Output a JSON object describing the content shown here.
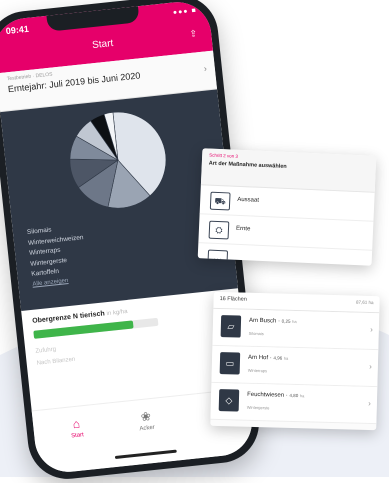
{
  "status": {
    "time": "09:41",
    "icons": "●●● ■"
  },
  "header": {
    "title": "Start",
    "share_icon": "share-icon"
  },
  "farm": {
    "label": "Testbetrieb · DELOS",
    "harvest_year": "Erntejahr: Juli 2019 bis Juni 2020"
  },
  "chart_data": {
    "type": "pie",
    "values": [
      40,
      15,
      12,
      10,
      8,
      7,
      5,
      3
    ],
    "colors": [
      "#dfe4ec",
      "#9aa4b3",
      "#6d7788",
      "#4d5666",
      "#7f8a9b",
      "#c0c7d2",
      "#0d1014",
      "#f3f5f8"
    ]
  },
  "crops": [
    "Silomais",
    "Winterweichweizen",
    "Winterraps",
    "Wintergerste",
    "Kartoffeln"
  ],
  "show_all": "Alle anzeigen",
  "limit": {
    "title": "Obergrenze N tierisch",
    "unit": "in kg/ha",
    "progress": 0.8
  },
  "faded": {
    "line1": "Zufuhrg",
    "line2": "Nach Bilanzen"
  },
  "tabs": [
    {
      "label": "Start",
      "icon": "home-icon"
    },
    {
      "label": "Acker",
      "icon": "field-icon"
    }
  ],
  "measure_card": {
    "step": "Schritt 2 von 3",
    "title": "Art der Maßnahme auswählen",
    "items": [
      {
        "label": "Aussaat",
        "icon": "tractor-icon"
      },
      {
        "label": "Ernte",
        "icon": "harvester-icon"
      }
    ]
  },
  "fields_card": {
    "title": "16 Flächen",
    "meta": "87,61 ha",
    "items": [
      {
        "name": "Am Busch",
        "area": "0,25",
        "unit": "ha",
        "crop": "Silomais"
      },
      {
        "name": "Am Hof",
        "area": "4,96",
        "unit": "ha",
        "crop": "Winterraps"
      },
      {
        "name": "Feuchtwiesen",
        "area": "4,80",
        "unit": "ha",
        "crop": "Wintergerste"
      }
    ]
  }
}
